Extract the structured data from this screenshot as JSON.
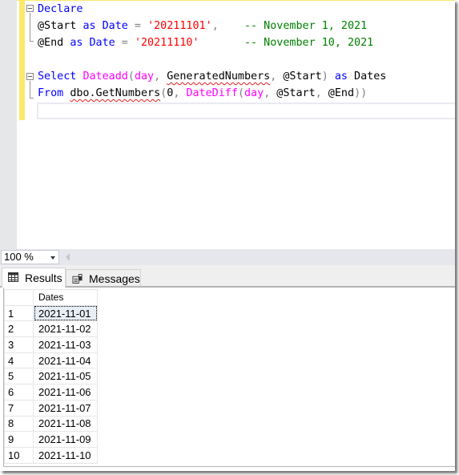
{
  "editor": {
    "lines": [
      [
        {
          "t": "Declare",
          "c": "kw"
        }
      ],
      [
        {
          "t": "@Start ",
          "c": ""
        },
        {
          "t": "as",
          "c": "kw"
        },
        {
          "t": " ",
          "c": ""
        },
        {
          "t": "Date",
          "c": "kw"
        },
        {
          "t": " = ",
          "c": "op"
        },
        {
          "t": "'20211101'",
          "c": "str"
        },
        {
          "t": ",",
          "c": "op"
        },
        {
          "t": "    -- November 1, 2021",
          "c": "cm"
        }
      ],
      [
        {
          "t": "@End ",
          "c": ""
        },
        {
          "t": "as",
          "c": "kw"
        },
        {
          "t": " ",
          "c": ""
        },
        {
          "t": "Date",
          "c": "kw"
        },
        {
          "t": " = ",
          "c": "op"
        },
        {
          "t": "'20211110'",
          "c": "str"
        },
        {
          "t": "       -- November 10, 2021",
          "c": "cm"
        }
      ],
      [],
      [
        {
          "t": "Select",
          "c": "kw"
        },
        {
          "t": " ",
          "c": ""
        },
        {
          "t": "Dateadd",
          "c": "fn"
        },
        {
          "t": "(",
          "c": "op"
        },
        {
          "t": "day",
          "c": "fn"
        },
        {
          "t": ",",
          "c": "op"
        },
        {
          "t": " ",
          "c": ""
        },
        {
          "t": "GeneratedNumbers",
          "c": "squig"
        },
        {
          "t": ",",
          "c": "op"
        },
        {
          "t": " @Start",
          "c": ""
        },
        {
          "t": ")",
          "c": "op"
        },
        {
          "t": " ",
          "c": ""
        },
        {
          "t": "as",
          "c": "kw"
        },
        {
          "t": " Dates",
          "c": ""
        }
      ],
      [
        {
          "t": "From",
          "c": "kw"
        },
        {
          "t": " ",
          "c": ""
        },
        {
          "t": "dbo.GetNumbers",
          "c": "squig"
        },
        {
          "t": "(",
          "c": "op"
        },
        {
          "t": "0",
          "c": ""
        },
        {
          "t": ",",
          "c": "op"
        },
        {
          "t": " ",
          "c": ""
        },
        {
          "t": "DateDiff",
          "c": "fn"
        },
        {
          "t": "(",
          "c": "op"
        },
        {
          "t": "day",
          "c": "fn"
        },
        {
          "t": ",",
          "c": "op"
        },
        {
          "t": " @Start",
          "c": ""
        },
        {
          "t": ",",
          "c": "op"
        },
        {
          "t": " @End",
          "c": ""
        },
        {
          "t": "))",
          "c": "op"
        }
      ]
    ]
  },
  "zoom": {
    "value": "100 %"
  },
  "tabs": [
    {
      "label": "Results",
      "icon": "grid-icon",
      "active": true
    },
    {
      "label": "Messages",
      "icon": "messages-icon",
      "active": false
    }
  ],
  "results": {
    "columns": [
      "Dates"
    ],
    "rows": [
      {
        "n": "1",
        "date": "2021-11-01"
      },
      {
        "n": "2",
        "date": "2021-11-02"
      },
      {
        "n": "3",
        "date": "2021-11-03"
      },
      {
        "n": "4",
        "date": "2021-11-04"
      },
      {
        "n": "5",
        "date": "2021-11-05"
      },
      {
        "n": "6",
        "date": "2021-11-06"
      },
      {
        "n": "7",
        "date": "2021-11-07"
      },
      {
        "n": "8",
        "date": "2021-11-08"
      },
      {
        "n": "9",
        "date": "2021-11-09"
      },
      {
        "n": "10",
        "date": "2021-11-10"
      }
    ],
    "selected_cell": {
      "row": 0,
      "column": "Dates"
    }
  },
  "colors": {
    "keyword": "#0000ff",
    "function": "#ff00ff",
    "string": "#ff0000",
    "comment": "#008000",
    "change_marker": "#fbe96b"
  }
}
